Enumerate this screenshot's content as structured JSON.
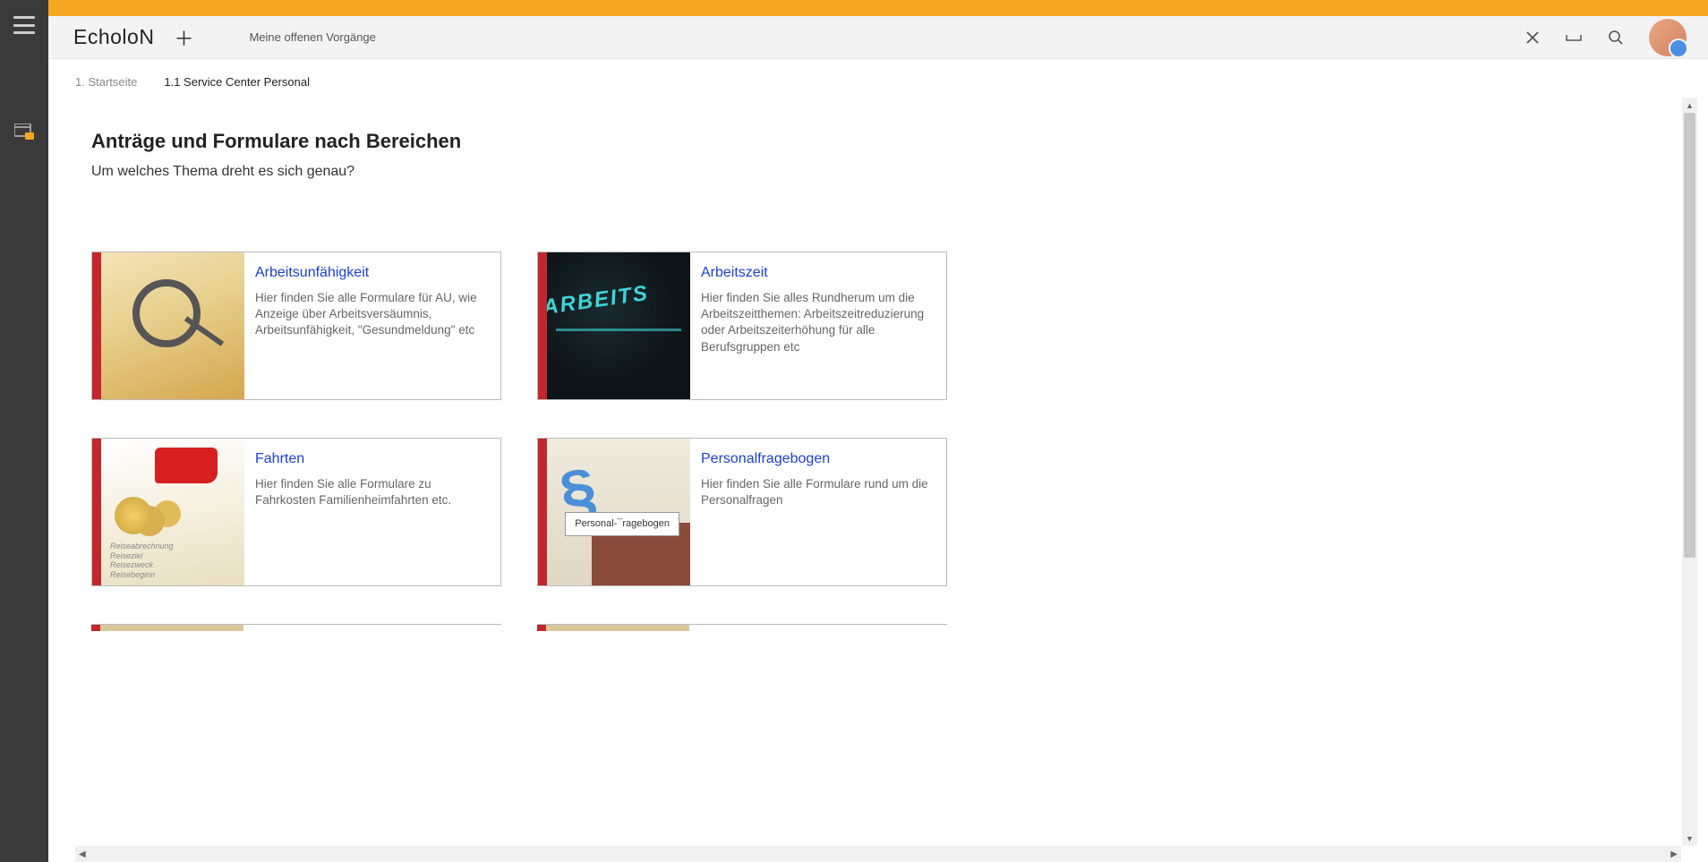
{
  "logo": "EcholoN",
  "header": {
    "tab": "Meine offenen Vorgänge"
  },
  "breadcrumb": {
    "item1": "1. Startseite",
    "item2": "1.1 Service Center Personal"
  },
  "page": {
    "title": "Anträge und Formulare nach Bereichen",
    "subtitle": "Um welches Thema dreht es sich genau?"
  },
  "cards": [
    {
      "title": "Arbeitsunfähigkeit",
      "desc": "Hier finden Sie alle Formulare für AU, wie Anzeige über Arbeitsversäumnis, Arbeitsunfähigkeit, \"Gesundmeldung\" etc"
    },
    {
      "title": "Arbeitszeit",
      "desc": "Hier finden Sie alles Rundherum um die Arbeitszeitthemen: Arbeitszeitreduzierung oder Arbeitszeiterhöhung für alle Berufsgruppen etc"
    },
    {
      "title": "Fahrten",
      "desc": "Hier finden Sie alle Formulare zu Fahrkosten Familienheimfahrten etc."
    },
    {
      "title": "Personalfragebogen",
      "desc": "Hier finden Sie alle Formulare rund um die Personalfragen"
    }
  ]
}
